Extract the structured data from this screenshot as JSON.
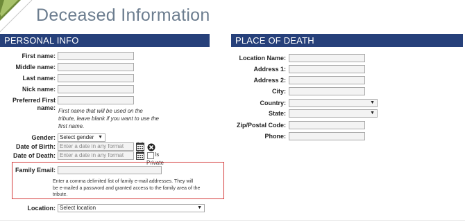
{
  "page": {
    "title": "Deceased Information"
  },
  "personal": {
    "header": "PERSONAL INFO",
    "first_name_label": "First name:",
    "middle_name_label": "Middle name:",
    "last_name_label": "Last name:",
    "nick_name_label": "Nick name:",
    "preferred_first_label_1": "Preferred First",
    "preferred_first_label_2": "name:",
    "preferred_hint_1": "First name that will be used on the",
    "preferred_hint_2": "tribute, leave blank if you want to use the",
    "preferred_hint_3": "first name.",
    "gender_label": "Gender:",
    "gender_value": "Select gender",
    "dob_label": "Date of Birth:",
    "dob_placeholder": "Enter a date in any format",
    "dod_label": "Date of Death:",
    "dod_placeholder": "Enter a date in any format",
    "is_private_1": "Is",
    "is_private_2": "Private",
    "family_email_label": "Family Email:",
    "family_email_help_1": "Enter a comma delimited list of family e-mail addresses. They will",
    "family_email_help_2": "be e-mailed a password and granted access to the family area of the",
    "family_email_help_3": "tribute.",
    "location_label": "Location:",
    "location_value": "Select location"
  },
  "death": {
    "header": "PLACE OF DEATH",
    "location_name_label": "Location Name:",
    "address1_label": "Address 1:",
    "address2_label": "Address 2:",
    "city_label": "City:",
    "country_label": "Country:",
    "state_label": "State:",
    "zip_label": "Zip/Postal Code:",
    "phone_label": "Phone:"
  },
  "colors": {
    "header_bg": "#26407a",
    "highlight": "#d43a3a",
    "title": "#6c7d8f"
  }
}
